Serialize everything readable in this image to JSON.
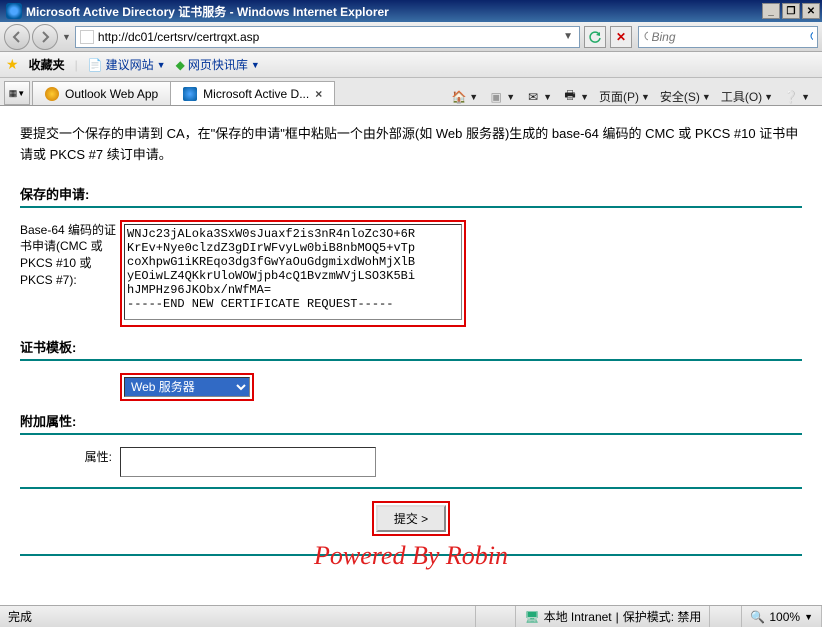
{
  "window": {
    "title": "Microsoft Active Directory 证书服务 - Windows Internet Explorer"
  },
  "nav": {
    "url": "http://dc01/certsrv/certrqxt.asp",
    "search_placeholder": "Bing"
  },
  "favorites": {
    "label": "收藏夹",
    "links": [
      {
        "label": "建议网站"
      },
      {
        "label": "网页快讯库"
      }
    ]
  },
  "tabs": [
    {
      "label": "Outlook Web App",
      "active": false
    },
    {
      "label": "Microsoft Active D...",
      "active": true
    }
  ],
  "commandbar": {
    "page_menu": "页面(P)",
    "safety_menu": "安全(S)",
    "tools_menu": "工具(O)"
  },
  "page": {
    "intro": "要提交一个保存的申请到 CA，在\"保存的申请\"框中粘贴一个由外部源(如 Web 服务器)生成的 base-64 编码的 CMC 或 PKCS #10 证书申请或 PKCS #7 续订申请。",
    "saved_heading": "保存的申请:",
    "csr_label": "Base-64 编码的证书申请(CMC 或 PKCS #10 或 PKCS #7):",
    "csr_text": "WNJc23jALoka3SxW0sJuaxf2is3nR4nloZc3O+6R\nKrEv+Nye0clzdZ3gDIrWFvyLw0biB8nbMOQ5+vTp\ncoXhpwG1iKREqo3dg3fGwYaOuGdgmixdWohMjXlB\nyEOiwLZ4QKkrUloWOWjpb4cQ1BvzmWVjLSO3K5Bi\nhJMPHz96JKObx/nWfMA=\n-----END NEW CERTIFICATE REQUEST-----",
    "template_heading": "证书模板:",
    "template_selected": "Web 服务器",
    "attrs_heading": "附加属性:",
    "attrs_label": "属性:",
    "attrs_value": "",
    "submit_label": "提交 >",
    "watermark": "Powered By Robin"
  },
  "status": {
    "done": "完成",
    "zone": "本地 Intranet",
    "protected_mode": "保护模式: 禁用",
    "zoom": "100%"
  }
}
